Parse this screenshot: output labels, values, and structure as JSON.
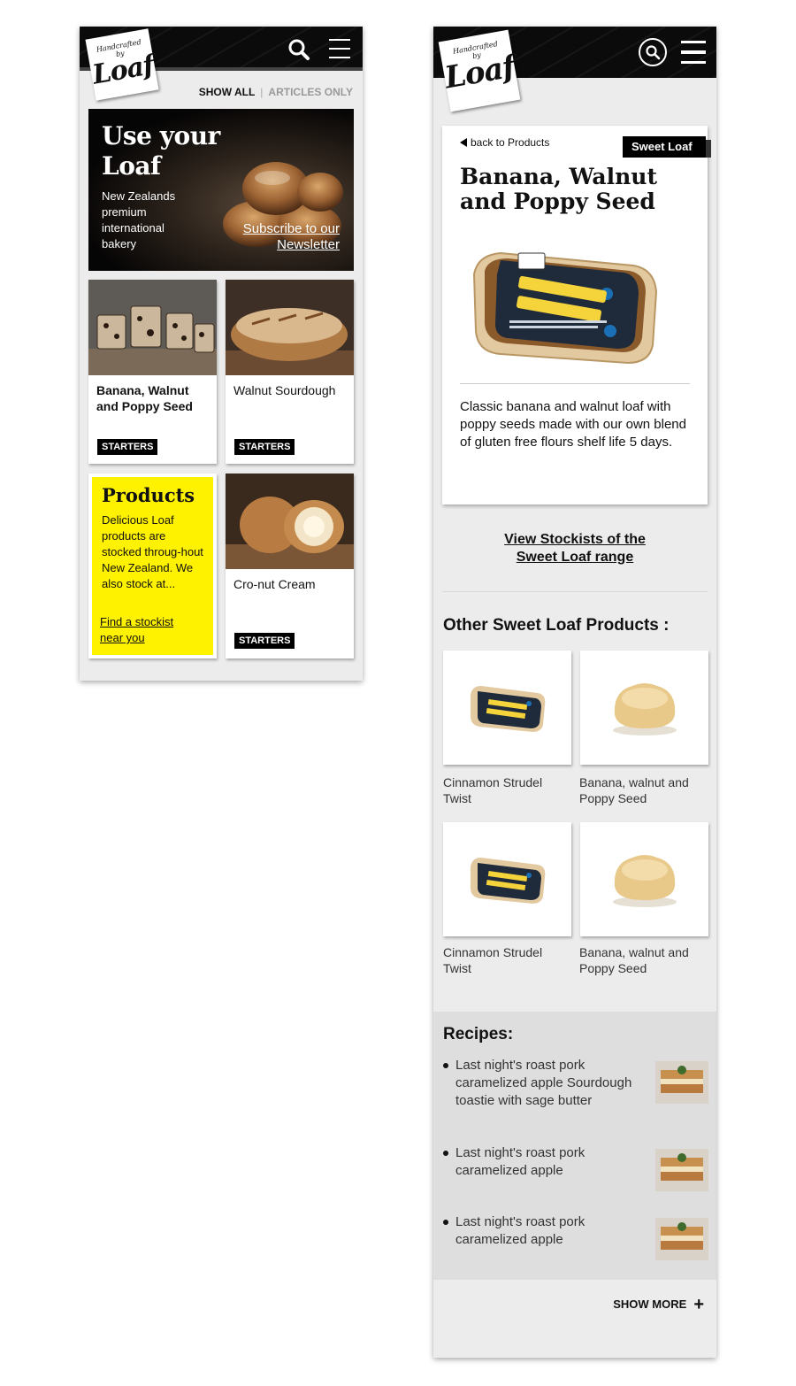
{
  "colors": {
    "topbar": "#0b0b0b",
    "accent_yellow": "#fff200",
    "tag_bg": "#000000",
    "page_bg": "#ececec"
  },
  "logo": {
    "line1": "Handcrafted",
    "line2": "by",
    "brand": "Loaf"
  },
  "phone_a": {
    "filter": {
      "show_all": "SHOW ALL",
      "separator": "|",
      "articles_only": "ARTICLES ONLY"
    },
    "hero": {
      "title_line1": "Use your",
      "title_line2": "Loaf",
      "description": "New Zealands premium international bakery",
      "subscribe_line1": "Subscribe to our",
      "subscribe_line2": "Newsletter"
    },
    "cards": [
      {
        "title": "Banana, Walnut and Poppy Seed",
        "tag": "STARTERS"
      },
      {
        "title": "Walnut Sourdough",
        "tag": "STARTERS"
      },
      {
        "title": "Cro-nut Cream",
        "tag": "STARTERS"
      }
    ],
    "products_card": {
      "title": "Products",
      "body": "Delicious Loaf products are stocked throug-hout New Zealand. We also stock at...",
      "link": "Find a stockist near you"
    }
  },
  "phone_b": {
    "back_link": "back to Products",
    "category_tag": "Sweet Loaf",
    "product_title": "Banana, Walnut and Poppy Seed",
    "product_description": "Classic banana and walnut loaf with poppy seeds made with our own blend of gluten free flours shelf life 5 days.",
    "stockists_line1": "View Stockists of the",
    "stockists_line2": "Sweet Loaf range",
    "other_heading": "Other Sweet Loaf Products :",
    "other_products": [
      {
        "name": "Cinnamon Strudel Twist",
        "icon": "loaf-package"
      },
      {
        "name": "Banana, walnut and Poppy Seed",
        "icon": "scone"
      },
      {
        "name": "Cinnamon Strudel Twist",
        "icon": "loaf-package"
      },
      {
        "name": "Banana, walnut and Poppy Seed",
        "icon": "scone"
      }
    ],
    "recipes_heading": "Recipes:",
    "recipes": [
      {
        "title": "Last night's roast pork caramelized apple Sourdough toastie with sage butter"
      },
      {
        "title": "Last night's roast pork caramelized apple"
      },
      {
        "title": "Last night's roast pork caramelized apple"
      }
    ],
    "show_more": "SHOW MORE",
    "show_more_icon": "+"
  }
}
